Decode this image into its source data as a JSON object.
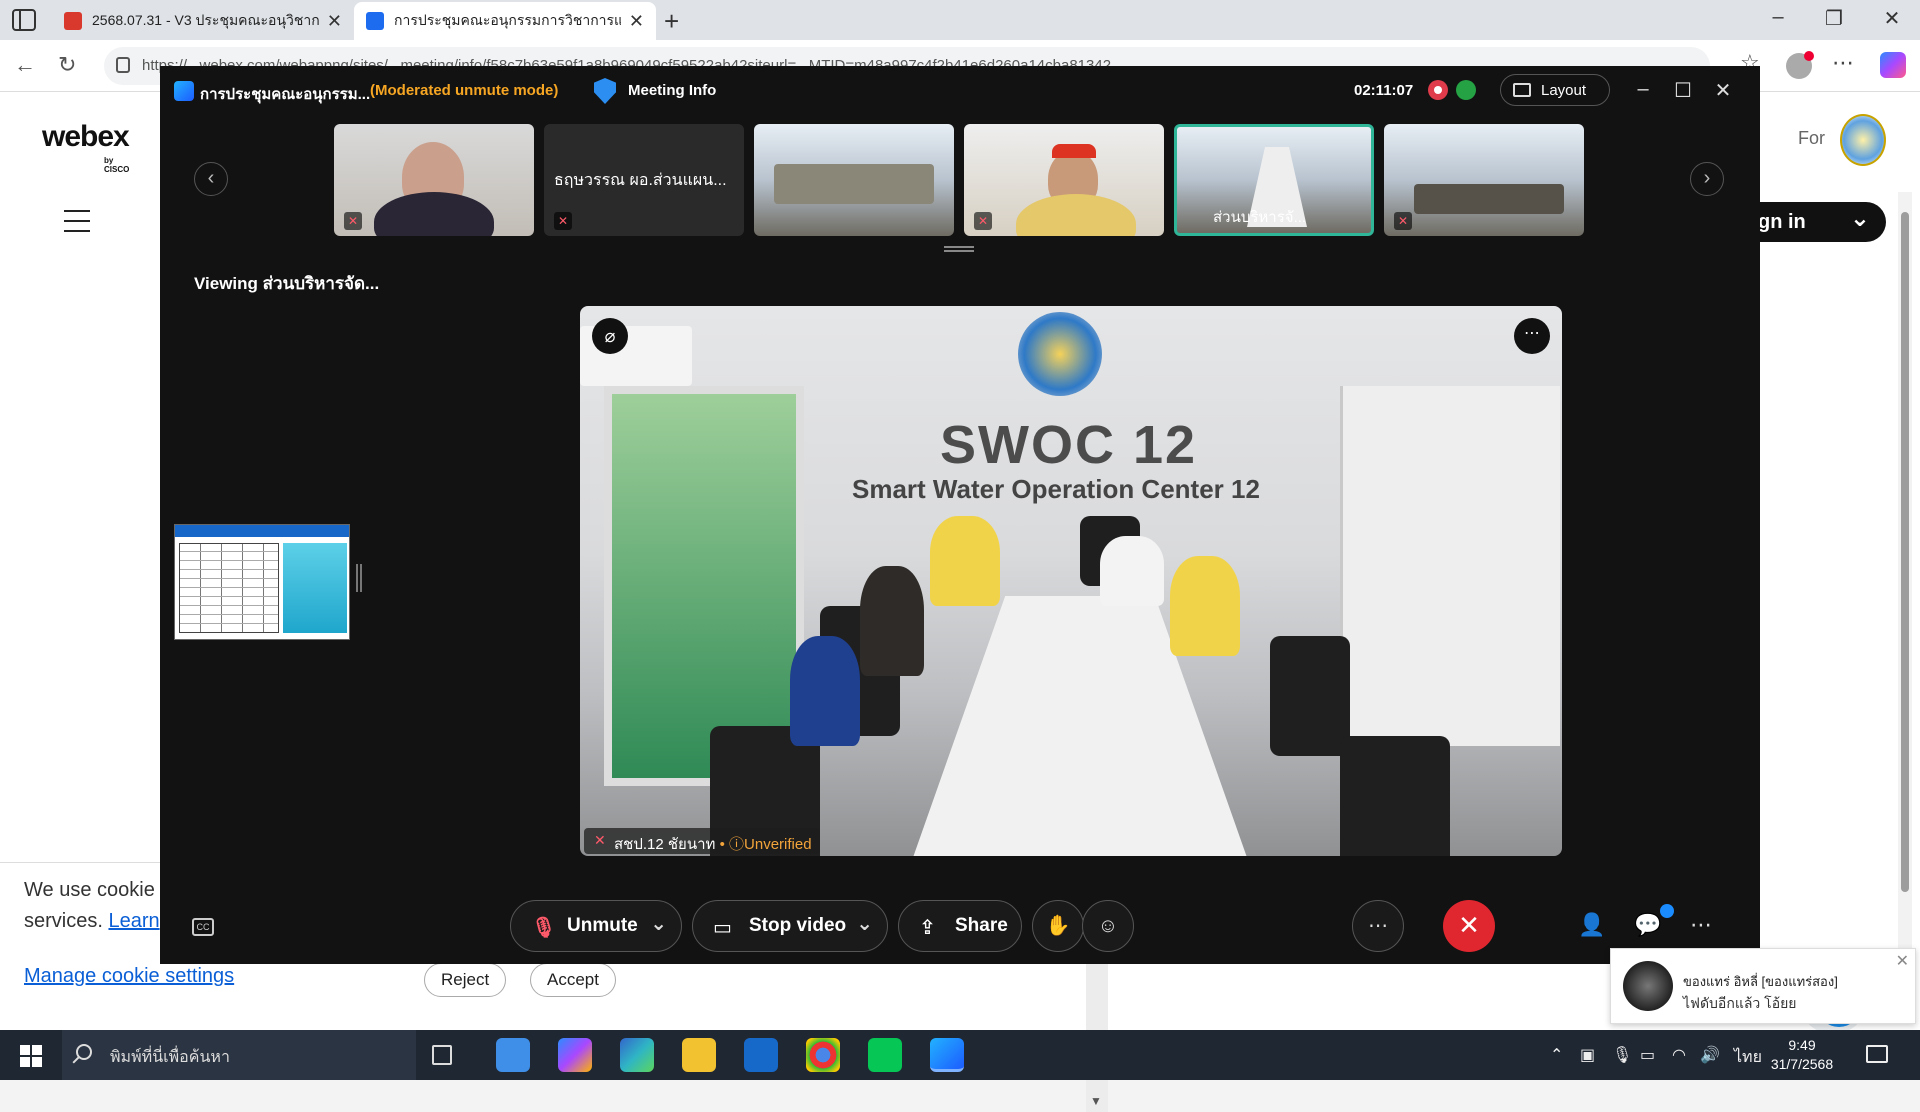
{
  "browser": {
    "tabs": [
      {
        "title": "2568.07.31 - V3 ประชุมคณะอนุวิชาการ",
        "active": false,
        "favicon_color": "#d9392c"
      },
      {
        "title": "การประชุมคณะอนุกรรมการวิชาการและ",
        "active": true,
        "favicon_color": "#1d6cf0"
      }
    ],
    "url": "https://...webex.com/webappng/sites/...meeting/info/f58c7b63e59f1a8b969049cf59522ab42siteurl=...MTID=m48a997c4f2b41e6d260a14cba81342",
    "window_buttons": {
      "minimize": "–",
      "maximize": "❐",
      "close": "✕"
    }
  },
  "page": {
    "logo": "webex",
    "logo_sub": "by CISCO",
    "for_text": "For",
    "signin_label": "gn in",
    "cookie_text_1": "We use cookie",
    "cookie_text_2": "services.",
    "cookie_learn": "Learn",
    "cookie_manage": "Manage cookie settings",
    "reject_label": "Reject",
    "accept_label": "Accept"
  },
  "meeting": {
    "title": "การประชุมคณะอนุกรรม...",
    "mode": "(Moderated unmute mode)",
    "info_label": "Meeting Info",
    "timer": "02:11:07",
    "layout_label": "Layout",
    "viewing": "Viewing ส่วนบริหารจัด...",
    "thumbnails": [
      {
        "name": "",
        "muted": true
      },
      {
        "name": "ธฤษวรรณ ผอ.ส่วนแผน...",
        "muted": true
      },
      {
        "name": "",
        "muted": false
      },
      {
        "name": "",
        "muted": true
      },
      {
        "name": "ส่วนบริหารจั...",
        "muted": false,
        "active": true
      },
      {
        "name": "",
        "muted": true
      }
    ],
    "main_video": {
      "sign_line1": "SWOC 12",
      "sign_line2": "Smart Water Operation Center 12",
      "participant": "สชป.12 ชัยนาท",
      "verification": "Unverified"
    },
    "controls": {
      "cc": "CC",
      "unmute": "Unmute",
      "stop_video": "Stop video",
      "share": "Share"
    }
  },
  "toast": {
    "name": "ของแทร่ อิหลี่ [ของแทร่สอง]",
    "message": "ไฟดับอีกแล้ว โอ้ยย"
  },
  "taskbar": {
    "search_placeholder": "พิมพ์ที่นี่เพื่อค้นหา",
    "lang": "ไทย",
    "time": "9:49",
    "date": "31/7/2568"
  }
}
